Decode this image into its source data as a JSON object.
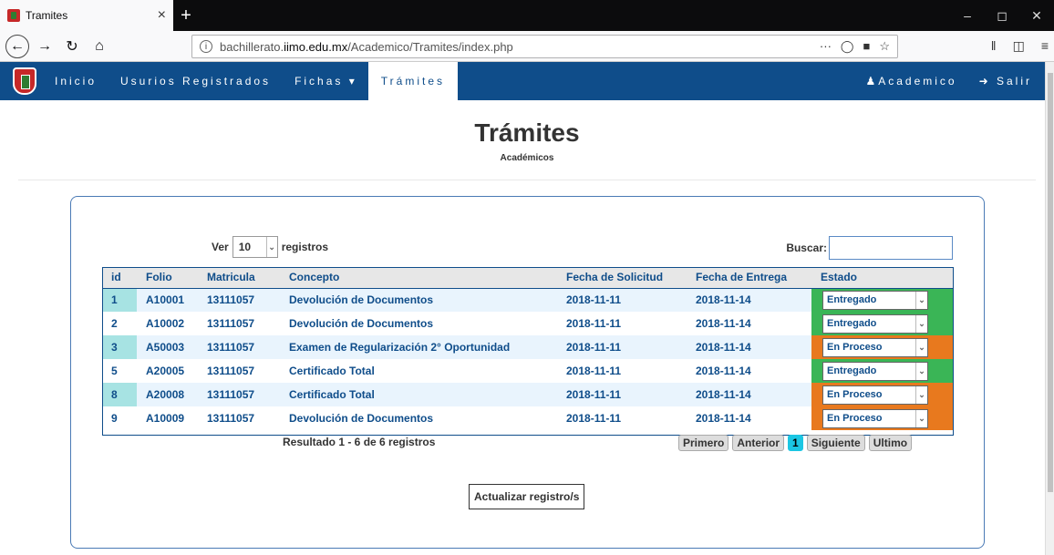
{
  "browser": {
    "tab_title": "Tramites",
    "tab_close": "×",
    "new_tab": "+",
    "url_prefix": "bachillerato.",
    "url_host": "iimo.edu.mx",
    "url_path": "/Academico/Tramites/index.php",
    "url_actions": "···",
    "controls": {
      "minimize": "–",
      "maximize": "◻",
      "close": "✕"
    }
  },
  "site_nav": {
    "items": [
      "Inicio",
      "Usurios Registrados",
      "Fichas ▾",
      "Trámites"
    ],
    "user": "Academico",
    "logout": "Salir"
  },
  "page": {
    "title": "Trámites",
    "subtitle": "Académicos"
  },
  "table_controls": {
    "ver_label": "Ver",
    "page_size": "10",
    "registros_label": "registros",
    "buscar_label": "Buscar:"
  },
  "table": {
    "headers": [
      "id",
      "Folio",
      "Matricula",
      "Concepto",
      "Fecha de Solicitud",
      "Fecha de Entrega",
      "Estado"
    ],
    "rows": [
      {
        "id": "1",
        "folio": "A10001",
        "matricula": "13111057",
        "concepto": "Devolución de Documentos",
        "solicitud": "2018-11-11",
        "entrega": "2018-11-14",
        "estado": "Entregado"
      },
      {
        "id": "2",
        "folio": "A10002",
        "matricula": "13111057",
        "concepto": "Devolución de Documentos",
        "solicitud": "2018-11-11",
        "entrega": "2018-11-14",
        "estado": "Entregado"
      },
      {
        "id": "3",
        "folio": "A50003",
        "matricula": "13111057",
        "concepto": "Examen de Regularización 2° Oportunidad",
        "solicitud": "2018-11-11",
        "entrega": "2018-11-14",
        "estado": "En Proceso"
      },
      {
        "id": "5",
        "folio": "A20005",
        "matricula": "13111057",
        "concepto": "Certificado Total",
        "solicitud": "2018-11-11",
        "entrega": "2018-11-14",
        "estado": "Entregado"
      },
      {
        "id": "8",
        "folio": "A20008",
        "matricula": "13111057",
        "concepto": "Certificado Total",
        "solicitud": "2018-11-11",
        "entrega": "2018-11-14",
        "estado": "En Proceso"
      },
      {
        "id": "9",
        "folio": "A10009",
        "matricula": "13111057",
        "concepto": "Devolución de Documentos",
        "solicitud": "2018-11-11",
        "entrega": "2018-11-14",
        "estado": "En Proceso"
      }
    ]
  },
  "footer": {
    "resultado": "Resultado 1 - 6 de 6 registros",
    "pager": {
      "first": "Primero",
      "prev": "Anterior",
      "current": "1",
      "next": "Siguiente",
      "last": "Ultimo"
    },
    "actualizar": "Actualizar registro/s"
  },
  "colors": {
    "nav_bg": "#0f4d8a",
    "entregado": "#3ab556",
    "en_proceso": "#e8791e",
    "pager_current": "#1bc6e3"
  }
}
